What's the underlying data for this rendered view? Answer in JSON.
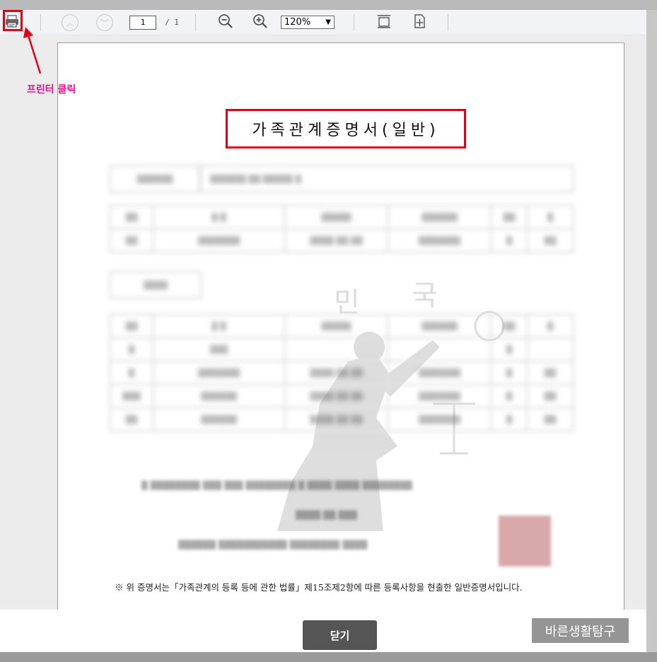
{
  "toolbar": {
    "page_current": "1",
    "page_total": "/ 1",
    "zoom": "120%"
  },
  "document": {
    "title": "가족관계증명서(일반)",
    "notice": "※ 위 증명서는「가족관계의 등록 등에 관한 법률」제15조제2항에 따른 등록사항을 현출한 일반증명서입니다."
  },
  "footer": {
    "close_label": "닫기",
    "watermark": "바른생활탐구"
  },
  "annotation": {
    "label": "프린터 클릭",
    "color": "#e0118f",
    "highlight_color": "#e0001a"
  }
}
